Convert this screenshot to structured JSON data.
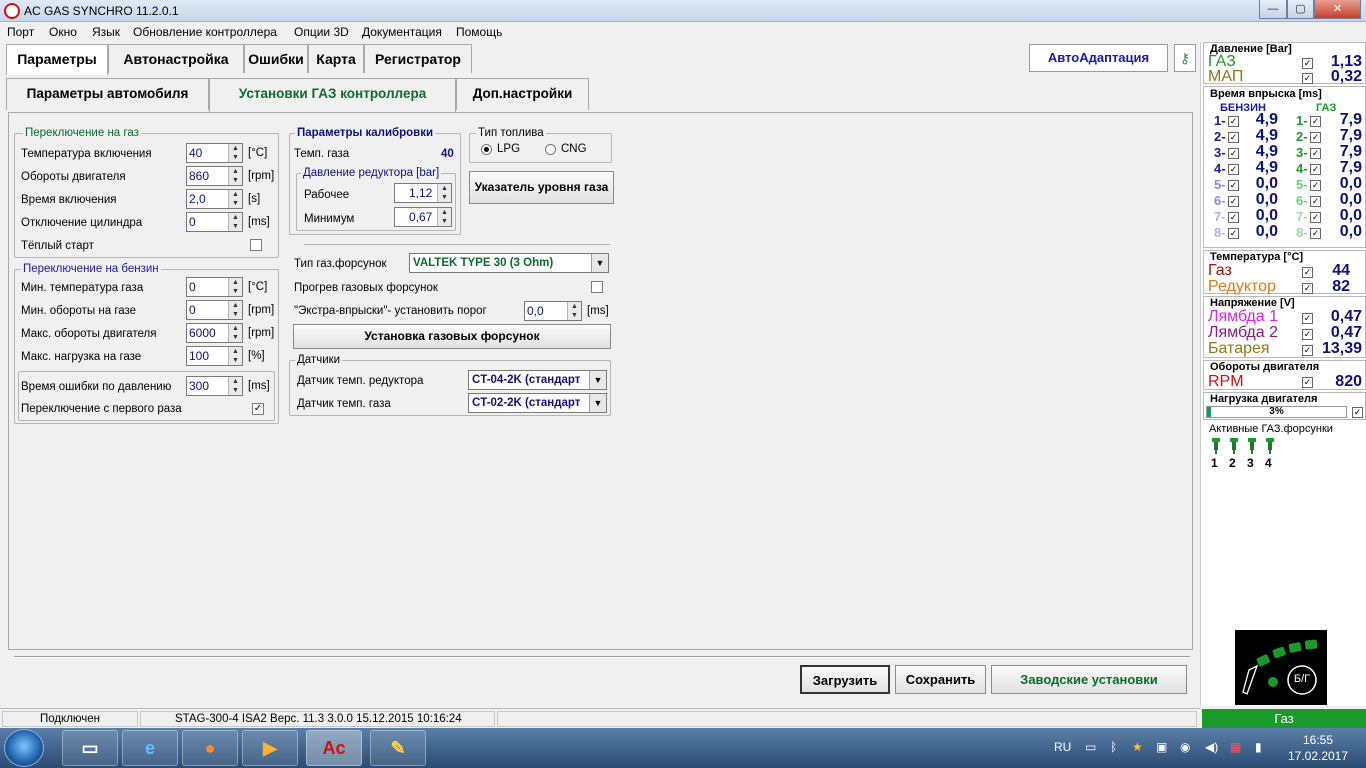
{
  "window": {
    "title": "AC GAS SYNCHRO  11.2.0.1",
    "minimize": "—",
    "maximize": "▢",
    "close": "✕"
  },
  "menu": [
    "Порт",
    "Окно",
    "Язык",
    "Обновление контроллера",
    "Опции 3D",
    "Документация",
    "Помощь"
  ],
  "tabs": [
    "Параметры",
    "Автонастройка",
    "Ошибки",
    "Карта",
    "Регистратор"
  ],
  "auto_adapt": "АвтоАдаптация",
  "key_icon": "key-icon",
  "subtabs": [
    "Параметры автомобиля",
    "Установки ГАЗ контроллера",
    "Доп.настройки"
  ],
  "switch_gas": {
    "title": "Переключение на газ",
    "rows": [
      {
        "label": "Температура включения",
        "value": "40",
        "unit": "[°C]"
      },
      {
        "label": "Обороты двигателя",
        "value": "860",
        "unit": "[rpm]"
      },
      {
        "label": "Время включения",
        "value": "2,0",
        "unit": "[s]"
      },
      {
        "label": "Отключение цилиндра",
        "value": "0",
        "unit": "[ms]"
      }
    ],
    "warm_start": "Тёплый старт"
  },
  "switch_petrol": {
    "title": "Переключение на бензин",
    "rows": [
      {
        "label": "Мин. температура газа",
        "value": "0",
        "unit": "[°C]"
      },
      {
        "label": "Мин. обороты на газе",
        "value": "0",
        "unit": "[rpm]"
      },
      {
        "label": "Макс. обороты двигателя",
        "value": "6000",
        "unit": "[rpm]"
      },
      {
        "label": "Макс. нагрузка на газе",
        "value": "100",
        "unit": "[%]"
      }
    ],
    "pressure_err_label": "Время ошибки по давлению",
    "pressure_err_value": "300",
    "pressure_err_unit": "[ms]",
    "first_switch": "Переключение с первого раза",
    "first_switch_checked": "✓"
  },
  "calibration": {
    "title": "Параметры калибровки",
    "gas_temp_label": "Темп. газа",
    "gas_temp_value": "40",
    "reducer_title": "Давление редуктора [bar]",
    "work_label": "Рабочее",
    "work_value": "1,12",
    "min_label": "Минимум",
    "min_value": "0,67"
  },
  "fuel_type": {
    "title": "Тип топлива",
    "lpg": "LPG",
    "cng": "CNG"
  },
  "gas_level_button": "Указатель уровня газа",
  "injectors": {
    "type_label": "Тип газ.форсунок",
    "type_value": "VALTEK TYPE 30 (3 Ohm)",
    "heating_label": "Прогрев газовых форсунок",
    "extra_label": "\"Экстра-впрыски\"- установить порог",
    "extra_value": "0,0",
    "extra_unit": "[ms]",
    "install_button": "Установка газовых форсунок"
  },
  "sensors": {
    "title": "Датчики",
    "reducer_label": "Датчик темп. редуктора",
    "reducer_value": "CT-04-2K (стандарт",
    "gas_label": "Датчик темп. газа",
    "gas_value": "CT-02-2K (стандарт"
  },
  "bottom_buttons": {
    "load": "Загрузить",
    "save": "Сохранить",
    "factory": "Заводские установки"
  },
  "status": {
    "connected": "Подключен",
    "device": "STAG-300-4 ISA2  Верс. 11.3  3.0.0    15.12.2015 10:16:24",
    "mode": "Газ"
  },
  "right_panel": {
    "pressure": {
      "title": "Давление [Bar]",
      "gas_label": "ГАЗ",
      "gas_value": "1,13",
      "map_label": "МАП",
      "map_value": "0,32"
    },
    "injection": {
      "title": "Время впрыска [ms]",
      "petrol_header": "БЕНЗИН",
      "gas_header": "ГАЗ",
      "rows": [
        {
          "n": "1-",
          "petrol": "4,9",
          "gas": "7,9"
        },
        {
          "n": "2-",
          "petrol": "4,9",
          "gas": "7,9"
        },
        {
          "n": "3-",
          "petrol": "4,9",
          "gas": "7,9"
        },
        {
          "n": "4-",
          "petrol": "4,9",
          "gas": "7,9"
        },
        {
          "n": "5-",
          "petrol": "0,0",
          "gas": "0,0"
        },
        {
          "n": "6-",
          "petrol": "0,0",
          "gas": "0,0"
        },
        {
          "n": "7-",
          "petrol": "0,0",
          "gas": "0,0"
        },
        {
          "n": "8-",
          "petrol": "0,0",
          "gas": "0,0"
        }
      ]
    },
    "temperature": {
      "title": "Температура  [°C]",
      "gas_label": "Газ",
      "gas_value": "44",
      "reducer_label": "Редуктор",
      "reducer_value": "82"
    },
    "voltage": {
      "title": "Напряжение [V]",
      "lambda1_label": "Лямбда 1",
      "lambda1_value": "0,47",
      "lambda2_label": "Лямбда 2",
      "lambda2_value": "0,47",
      "battery_label": "Батарея",
      "battery_value": "13,39"
    },
    "rpm": {
      "title": "Обороты двигателя",
      "label": "RPM",
      "value": "820"
    },
    "load": {
      "title": "Нагрузка двигателя",
      "value": "3%",
      "fraction": 0.03
    },
    "active_injectors": {
      "title": "Активные ГАЗ.форсунки",
      "numbers": [
        "1",
        "2",
        "3",
        "4"
      ]
    },
    "switch_logo": "Б/Г"
  },
  "taskbar": {
    "lang": "RU",
    "time": "16:55",
    "date": "17.02.2017"
  },
  "colors": {
    "gas_green": "#1a9a2a",
    "value_blue": "#10107a",
    "lambda1": "#e020e0",
    "lambda2": "#8a1a8a",
    "battery": "#8a7a1a",
    "rpm_red": "#d01010"
  }
}
